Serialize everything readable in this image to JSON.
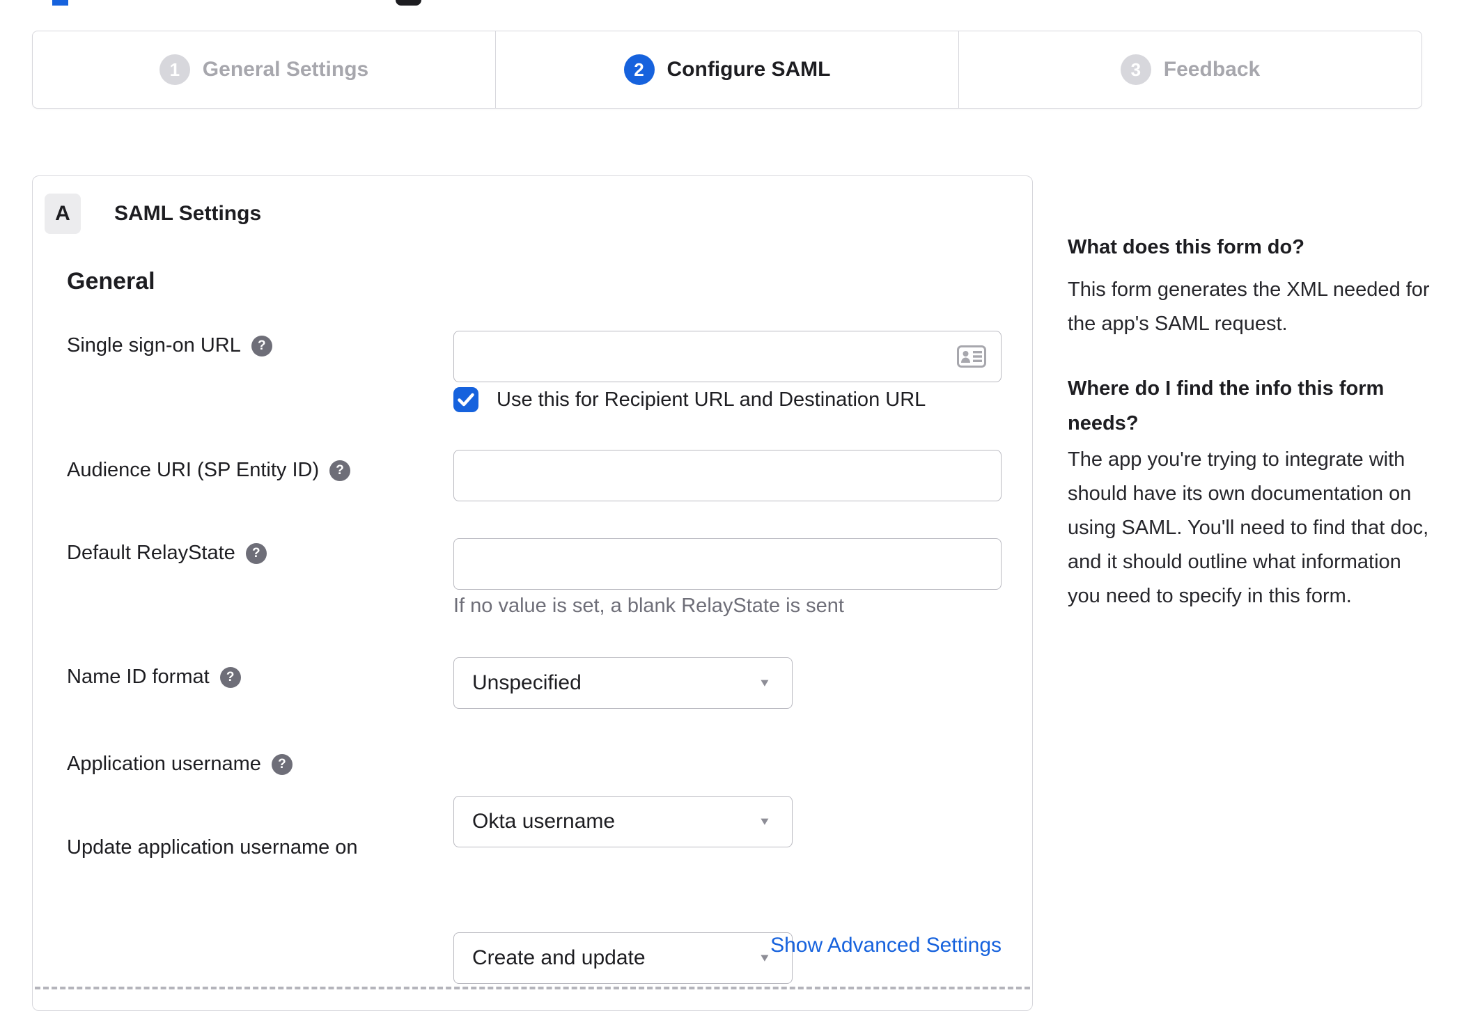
{
  "stepper": {
    "active_step": "2",
    "steps": [
      {
        "number": "1",
        "label": "General Settings"
      },
      {
        "number": "2",
        "label": "Configure SAML"
      },
      {
        "number": "3",
        "label": "Feedback"
      }
    ]
  },
  "panel": {
    "badge": "A",
    "title": "SAML Settings",
    "section_heading": "General",
    "fields": {
      "sso_url": {
        "label": "Single sign-on URL",
        "value": "",
        "checkbox_label": "Use this for Recipient URL and Destination URL",
        "checkbox_checked": true
      },
      "audience_uri": {
        "label": "Audience URI (SP Entity ID)",
        "value": ""
      },
      "default_relay_state": {
        "label": "Default RelayState",
        "value": "",
        "helper_text": "If no value is set, a blank RelayState is sent"
      },
      "name_id_format": {
        "label": "Name ID format",
        "selected": "Unspecified"
      },
      "application_username": {
        "label": "Application username",
        "selected": "Okta username"
      },
      "update_application_username_on": {
        "label": "Update application username on",
        "selected": "Create and update"
      }
    },
    "advanced_settings_link": "Show Advanced Settings"
  },
  "help_panel": {
    "heading_1": "What does this form do?",
    "paragraph_1": "This form generates the XML needed for the app's SAML request.",
    "heading_2": "Where do I find the info this form needs?",
    "paragraph_2": "The app you're trying to integrate with should have its own documentation on using SAML. You'll need to find that doc, and it should outline what information you need to specify in this form."
  },
  "icons": {
    "help_glyph": "?",
    "dropdown_glyph": "▼"
  },
  "colors": {
    "accent_blue": "#1662dd",
    "text_primary": "#1d1d21",
    "text_muted": "#6e6e78",
    "inactive_gray": "#d7d7dc",
    "inactive_label_gray": "#a7a7ad",
    "panel_border": "#d7d7dc",
    "input_border": "#b9b9c0"
  }
}
